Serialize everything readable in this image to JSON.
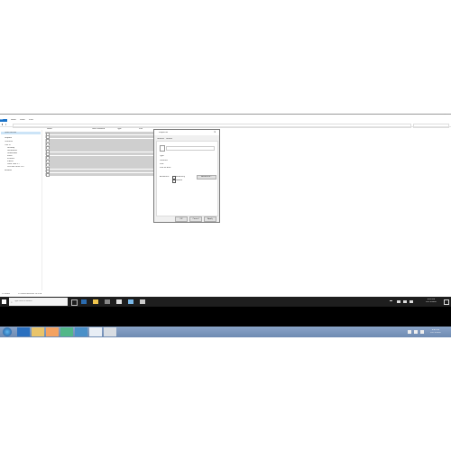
{
  "explorer": {
    "ribbon_tabs": [
      "File",
      "Home",
      "Share",
      "View"
    ],
    "nav_items": [
      "Quick access",
      "Dropbox",
      "OneDrive",
      "This PC",
      "Desktop",
      "Documents",
      "Downloads",
      "Music",
      "Pictures",
      "Videos",
      "Local Disk (C:)",
      "DVD RW Drive (D:)",
      "Network"
    ],
    "columns": [
      "Name",
      "Date modified",
      "Type",
      "Size"
    ],
    "row_count": 13,
    "status": "13 items",
    "status_selected": "13 items selected 13.5 KB"
  },
  "dialog": {
    "title": "Properties",
    "tabs": [
      "General",
      "Details"
    ],
    "fields": [
      {
        "label": "Type:",
        "value": ""
      },
      {
        "label": "Location:",
        "value": ""
      },
      {
        "label": "Size:",
        "value": ""
      },
      {
        "label": "Size on disk:",
        "value": ""
      },
      {
        "label": "Attributes:",
        "value": "Read-only"
      }
    ],
    "checkbox_hidden": "Hidden",
    "advanced": "Advanced...",
    "ok": "OK",
    "cancel": "Cancel",
    "apply": "Apply"
  },
  "taskbar10": {
    "search_placeholder": "Type here to search",
    "time": "4:09 PM",
    "date": "12/11/2018"
  },
  "taskbar7": {
    "time": "8:43 PM",
    "date": "12/11/2018"
  },
  "colors": {
    "taskbar10": "#1e1e1e",
    "selected_row": "#cfcfcf",
    "taskbar7": "#7a94bc",
    "accent": "#1a73c9"
  }
}
